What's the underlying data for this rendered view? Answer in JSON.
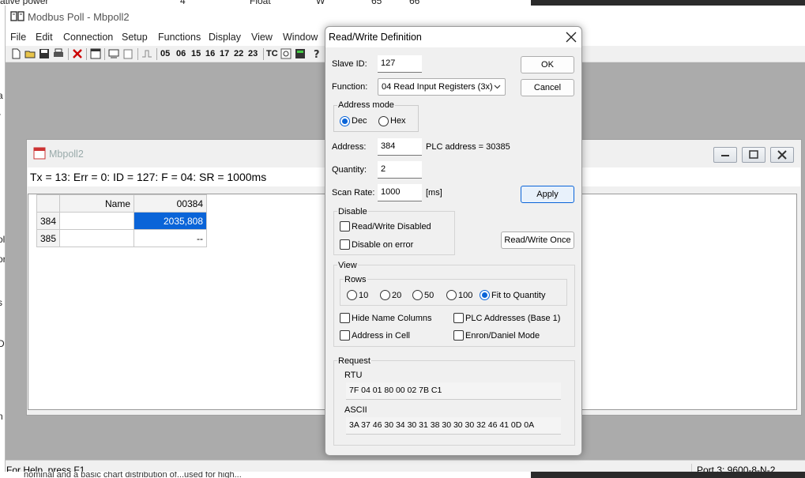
{
  "background": {
    "top_text": [
      "ative power",
      "4",
      "Float",
      "W",
      "65",
      "66"
    ],
    "bottom_text": "nominal and a basic chart distribution of...used for high...",
    "left_chars": [
      "a",
      "r",
      "",
      "ol",
      "or",
      "s",
      "D",
      "n"
    ]
  },
  "app": {
    "title": "Modbus Poll - Mbpoll2",
    "menu": [
      "File",
      "Edit",
      "Connection",
      "Setup",
      "Functions",
      "Display",
      "View",
      "Window"
    ],
    "function_codes": [
      "05",
      "06",
      "15",
      "16",
      "17",
      "22",
      "23"
    ],
    "tc_label": "TC",
    "status_left": "For Help, press F1.",
    "status_right": "Port 3: 9600-8-N-2"
  },
  "child": {
    "title": "Mbpoll2",
    "status_line": "Tx = 13: Err = 0: ID = 127: F = 04: SR = 1000ms",
    "grid": {
      "headers": [
        "",
        "Name",
        "00384"
      ],
      "rows": [
        {
          "num": "384",
          "name": "",
          "value": "2035,808"
        },
        {
          "num": "385",
          "name": "",
          "value": "--"
        }
      ]
    }
  },
  "dialog": {
    "title": "Read/Write Definition",
    "slave_id_label": "Slave ID:",
    "slave_id": "127",
    "function_label": "Function:",
    "function_value": "04 Read Input Registers (3x)",
    "address_mode_label": "Address mode",
    "dec_label": "Dec",
    "hex_label": "Hex",
    "address_label": "Address:",
    "address": "384",
    "plc_address": "PLC address = 30385",
    "quantity_label": "Quantity:",
    "quantity": "2",
    "scan_rate_label": "Scan Rate:",
    "scan_rate": "1000",
    "scan_unit": "[ms]",
    "ok_label": "OK",
    "cancel_label": "Cancel",
    "apply_label": "Apply",
    "disable_label": "Disable",
    "rw_disabled_label": "Read/Write Disabled",
    "disable_on_error_label": "Disable on error",
    "rw_once_label": "Read/Write Once",
    "view_label": "View",
    "rows_label": "Rows",
    "rows_options": [
      "10",
      "20",
      "50",
      "100",
      "Fit to Quantity"
    ],
    "rows_selected": "Fit to Quantity",
    "hide_name_label": "Hide Name Columns",
    "plc_addresses_label": "PLC Addresses (Base 1)",
    "address_in_cell_label": "Address in Cell",
    "enron_label": "Enron/Daniel Mode",
    "request_label": "Request",
    "rtu_label": "RTU",
    "rtu_value": "7F 04 01 80 00 02 7B C1",
    "ascii_label": "ASCII",
    "ascii_value": "3A 37 46 30 34 30 31 38 30 30 30 32 46 41 0D 0A"
  },
  "colors": {
    "selection": "#0a64d8",
    "mdi_background": "#ababab"
  }
}
